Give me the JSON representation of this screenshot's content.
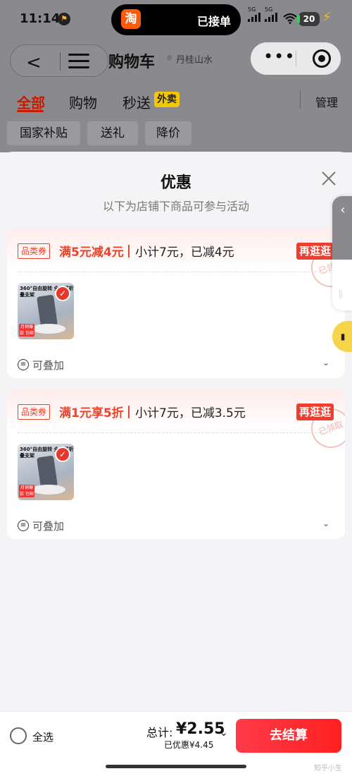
{
  "status": {
    "time": "11:14",
    "island_app": "淘",
    "island_text": "已接单",
    "signal_1_label": "5G",
    "signal_2_label": "5G",
    "battery": "20"
  },
  "header": {
    "title": "购物车",
    "location": "丹桂山水",
    "more_icon": "more-icon",
    "target_icon": "target-icon"
  },
  "tabs": [
    {
      "label": "全部",
      "active": true
    },
    {
      "label": "购物",
      "active": false
    },
    {
      "label": "秒送",
      "active": false
    }
  ],
  "waimai_badge": "外卖",
  "manage": "管理",
  "filters": [
    "国家补贴",
    "送礼",
    "降价"
  ],
  "sheet": {
    "title": "优惠",
    "subtitle": "以下为店铺下商品可参与活动"
  },
  "cards": [
    {
      "tag": "品类券",
      "deal": "满5元减4元",
      "subtotal": "小计7元，已减4元",
      "more_button": "再逛逛",
      "stamp": "已领取",
      "product_title": "360°自由旋转 全金属折叠支架",
      "product_badge": "月销爆款 包邮",
      "stack_label": "可叠加"
    },
    {
      "tag": "品类券",
      "deal": "满1元享5折",
      "subtotal": "小计7元，已减3.5元",
      "more_button": "再逛逛",
      "stamp": "已领取",
      "product_title": "360°自由旋转 全金属折叠支架",
      "product_badge": "月销爆款 包邮",
      "stack_label": "可叠加"
    }
  ],
  "bottom": {
    "select_all": "全选",
    "total_label": "总计:",
    "total_amount": "¥2.55",
    "saved": "已优惠¥4.45",
    "checkout": "去结算"
  },
  "watermark": "知乎小生",
  "colors": {
    "accent_red": "#e8452c",
    "checkout_red": "#ff2020",
    "waimai_yellow": "#f4c800"
  }
}
